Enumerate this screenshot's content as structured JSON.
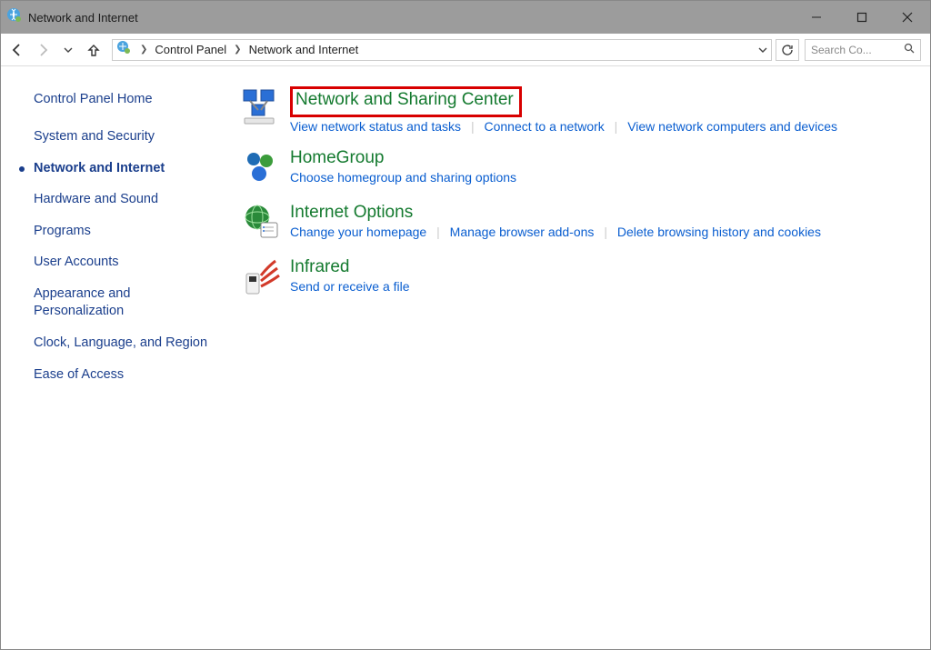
{
  "window": {
    "title": "Network and Internet"
  },
  "toolbar": {
    "breadcrumb": [
      "Control Panel",
      "Network and Internet"
    ],
    "search_placeholder": "Search Co..."
  },
  "sidebar": {
    "home": "Control Panel Home",
    "items": [
      {
        "label": "System and Security",
        "active": false
      },
      {
        "label": "Network and Internet",
        "active": true
      },
      {
        "label": "Hardware and Sound",
        "active": false
      },
      {
        "label": "Programs",
        "active": false
      },
      {
        "label": "User Accounts",
        "active": false
      },
      {
        "label": "Appearance and Personalization",
        "active": false
      },
      {
        "label": "Clock, Language, and Region",
        "active": false
      },
      {
        "label": "Ease of Access",
        "active": false
      }
    ]
  },
  "categories": [
    {
      "title": "Network and Sharing Center",
      "highlight": true,
      "links": [
        "View network status and tasks",
        "Connect to a network",
        "View network computers and devices"
      ]
    },
    {
      "title": "HomeGroup",
      "highlight": false,
      "links": [
        "Choose homegroup and sharing options"
      ]
    },
    {
      "title": "Internet Options",
      "highlight": false,
      "links": [
        "Change your homepage",
        "Manage browser add-ons",
        "Delete browsing history and cookies"
      ]
    },
    {
      "title": "Infrared",
      "highlight": false,
      "links": [
        "Send or receive a file"
      ]
    }
  ],
  "colors": {
    "link": "#0a5ed0",
    "green": "#147a2f",
    "highlight_border": "#d80000"
  }
}
